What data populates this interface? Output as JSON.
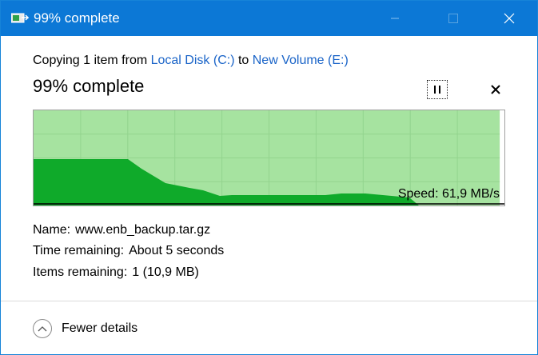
{
  "window": {
    "title": "99% complete"
  },
  "header": {
    "copy_prefix": "Copying 1 item from ",
    "source": "Local Disk (C:)",
    "copy_middle": " to ",
    "destination": "New Volume (E:)",
    "progress_title": "99% complete",
    "progress_fraction": 0.99
  },
  "graph": {
    "speed_label": "Speed: 61,9 MB/s",
    "colors": {
      "fill_light": "#a6e3a0",
      "fill_dark": "#0faa2a",
      "grid": "#93d48e",
      "speed_line": "#000000"
    }
  },
  "details": {
    "name_label": "Name:",
    "name_value": "www.enb_backup.tar.gz",
    "time_label": "Time remaining:",
    "time_value": "About 5 seconds",
    "items_label": "Items remaining:",
    "items_value": "1 (10,9 MB)"
  },
  "footer": {
    "toggle_label": "Fewer details"
  },
  "icons": {
    "app": "file-copy-icon",
    "minimize": "minimize-icon",
    "maximize": "maximize-icon",
    "close": "close-icon",
    "pause": "pause-icon",
    "cancel": "cancel-icon",
    "chevron": "chevron-up-icon"
  }
}
